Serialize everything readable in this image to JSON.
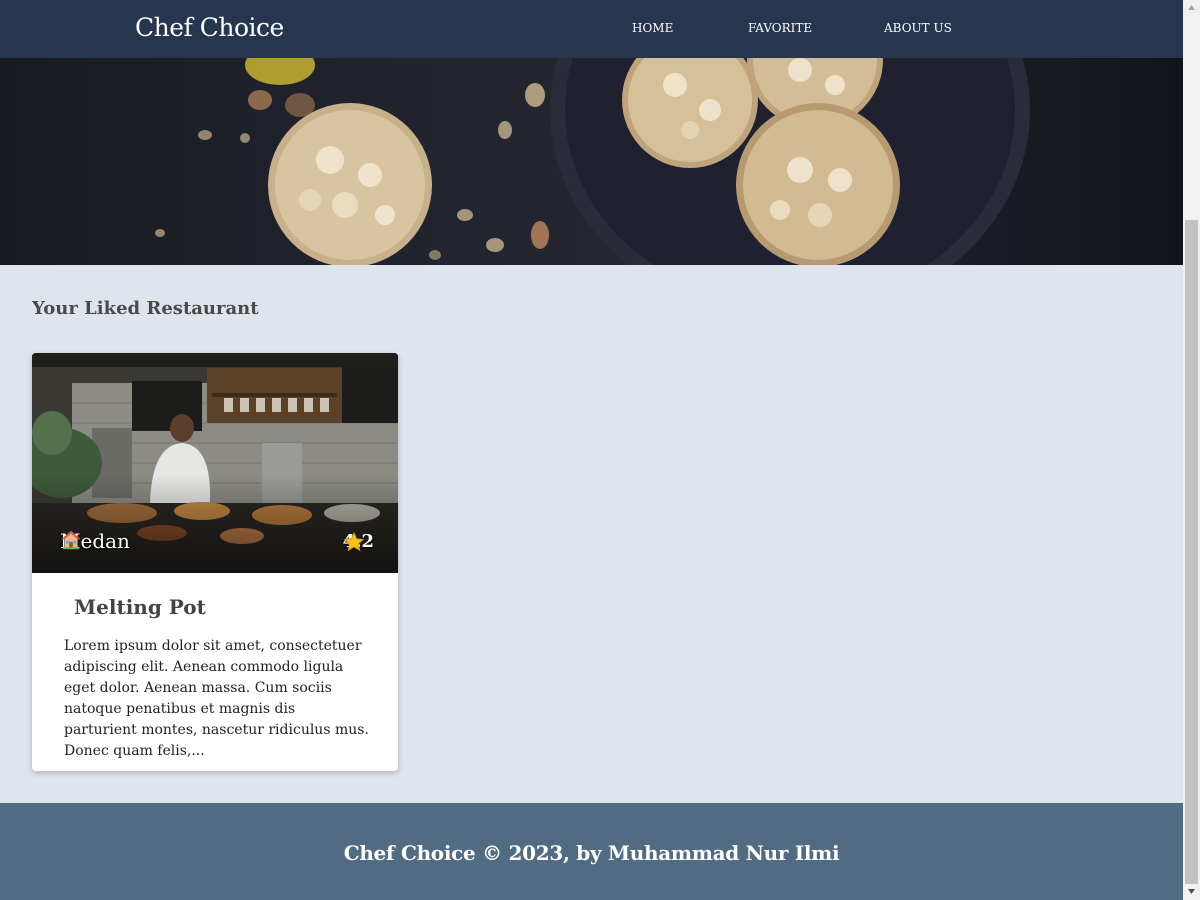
{
  "nav": {
    "brand": "Chef Choice",
    "links": [
      "HOME",
      "FAVORITE",
      "ABOUT US"
    ]
  },
  "main": {
    "section_title": "Your Liked Restaurant",
    "cards": [
      {
        "city": "Medan",
        "rating": "4.2",
        "name": "Melting Pot",
        "description": "Lorem ipsum dolor sit amet, consectetuer adipiscing elit. Aenean commodo ligula eget dolor. Aenean massa. Cum sociis natoque penatibus et magnis dis parturient montes, nascetur ridiculus mus. Donec quam felis,..."
      }
    ]
  },
  "footer": {
    "text": "Chef Choice © 2023, by Muhammad Nur Ilmi"
  },
  "icons": {
    "city": "house-icon",
    "rating": "star-icon"
  },
  "colors": {
    "navbar": "#27364f",
    "background": "#dfe5ed",
    "footer": "#516b83",
    "star": "#f5c518"
  }
}
